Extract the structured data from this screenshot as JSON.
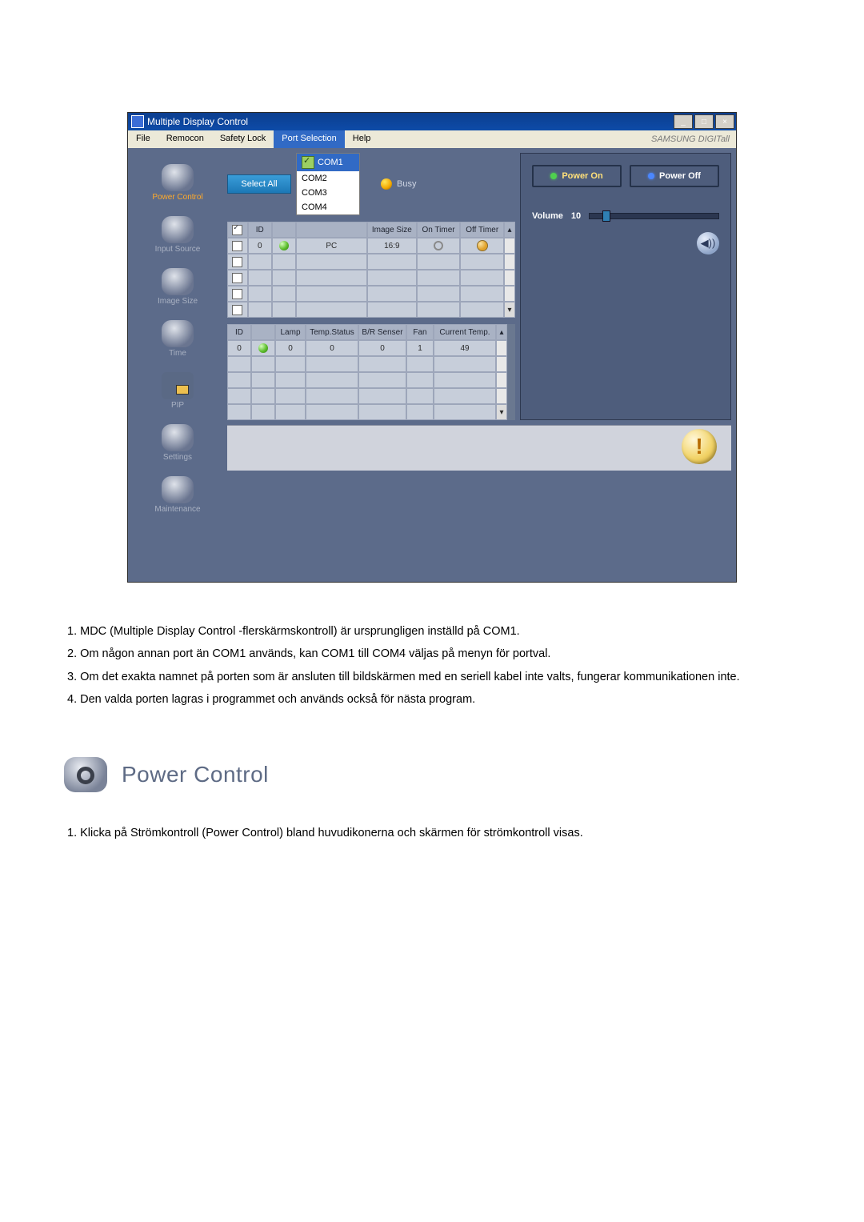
{
  "window": {
    "title": "Multiple Display Control",
    "brand": "SAMSUNG DIGITall"
  },
  "menu": {
    "file": "File",
    "remocon": "Remocon",
    "safety_lock": "Safety Lock",
    "port_selection": "Port Selection",
    "help": "Help"
  },
  "sidebar": {
    "power_control": "Power Control",
    "input_source": "Input Source",
    "image_size": "Image Size",
    "time": "Time",
    "pip": "PIP",
    "settings": "Settings",
    "maintenance": "Maintenance"
  },
  "controls": {
    "select_all": "Select All",
    "com_options": [
      "COM1",
      "COM2",
      "COM3",
      "COM4"
    ],
    "busy_label": "Busy"
  },
  "grid1": {
    "headers": {
      "id": "ID",
      "src": "",
      "isize": "Image Size",
      "on": "On Timer",
      "off": "Off Timer"
    },
    "row": {
      "id": "0",
      "src": "PC",
      "isize": "16:9"
    }
  },
  "grid2": {
    "headers": {
      "id": "ID",
      "lamp": "Lamp",
      "tstat": "Temp.Status",
      "br": "B/R Senser",
      "fan": "Fan",
      "cur": "Current Temp."
    },
    "row": {
      "id": "0",
      "lamp": "0",
      "tstat": "0",
      "br": "0",
      "fan": "1",
      "cur": "49"
    }
  },
  "panel": {
    "power_on": "Power On",
    "power_off": "Power Off",
    "volume_label": "Volume",
    "volume_value": "10"
  },
  "notes": {
    "n1": "1.  MDC (Multiple Display Control -flerskärmskontroll) är ursprungligen inställd på COM1.",
    "n2": "2.  Om någon annan port än COM1 används, kan COM1 till COM4 väljas på menyn för portval.",
    "n3": "3.  Om det exakta namnet på porten som är ansluten till bildskärmen med en seriell kabel inte valts, fungerar kommunikationen inte.",
    "n4": "4.  Den valda porten lagras i programmet och används också för nästa program."
  },
  "section": {
    "title": "Power Control",
    "line1": "1.  Klicka på Strömkontroll (Power Control) bland huvudikonerna och skärmen för strömkontroll visas."
  }
}
